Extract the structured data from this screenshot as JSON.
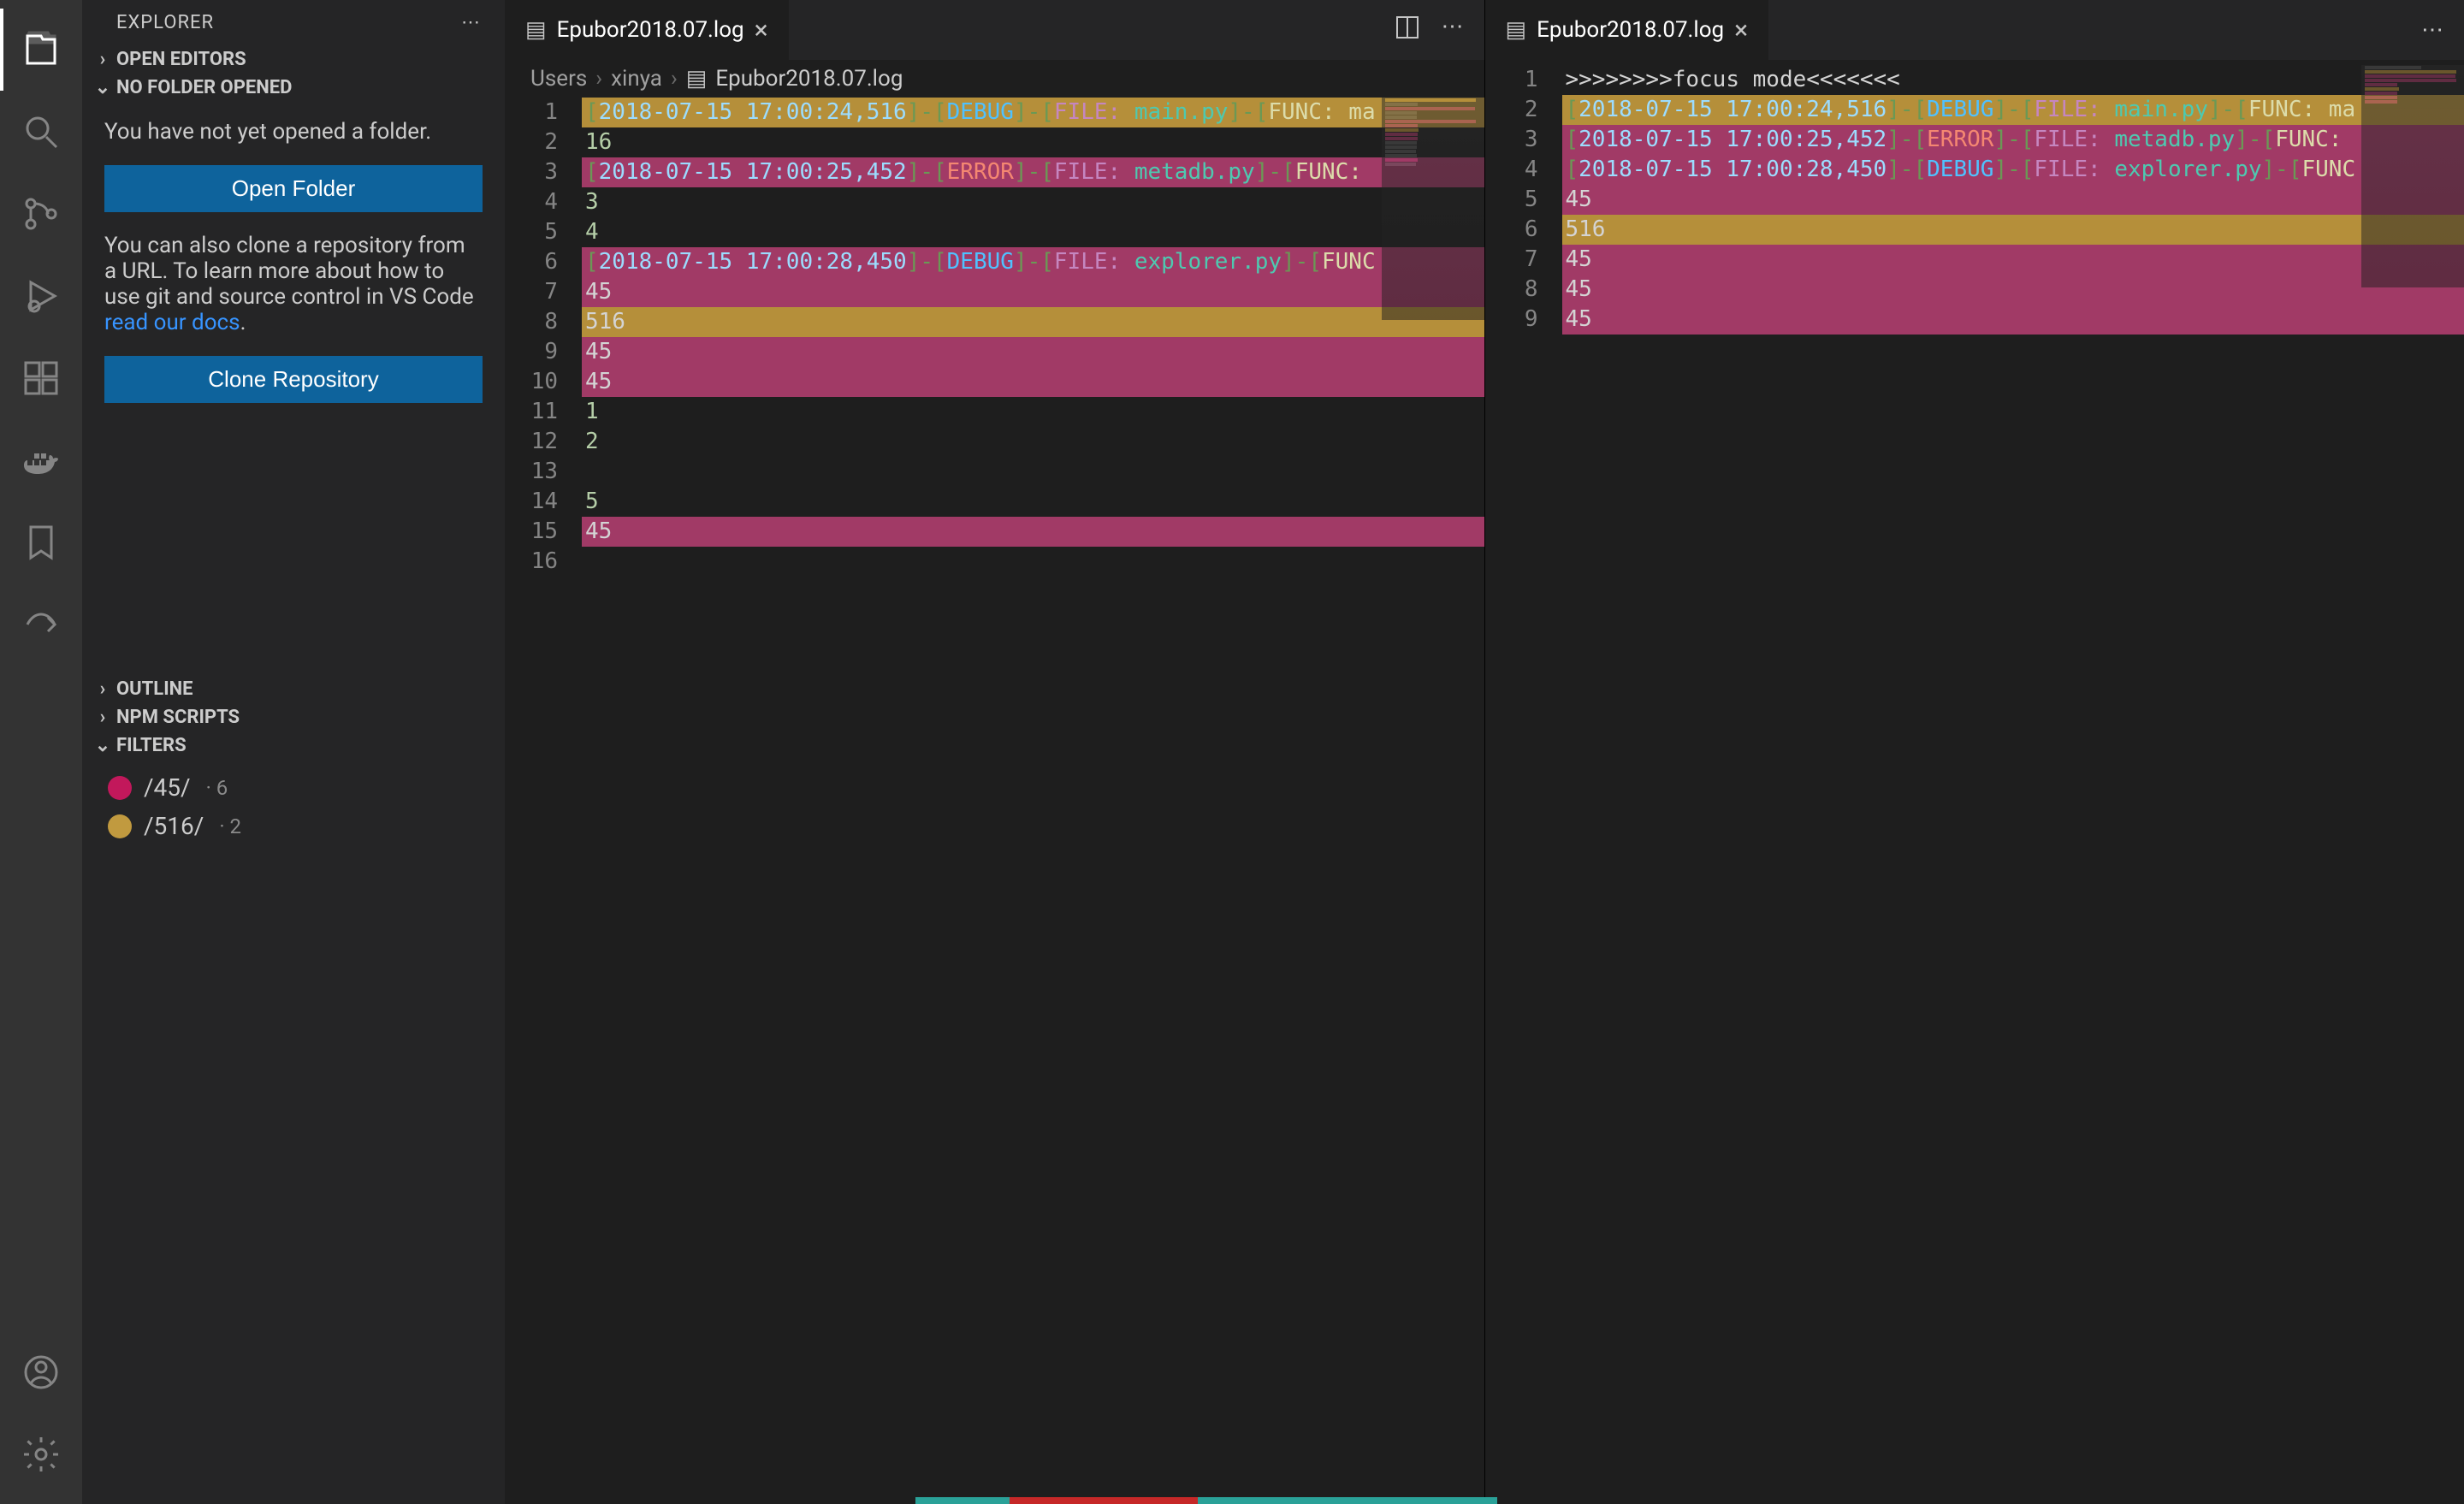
{
  "sidebar": {
    "title": "EXPLORER",
    "sections": {
      "openEditors": "OPEN EDITORS",
      "noFolder": "NO FOLDER OPENED",
      "outline": "OUTLINE",
      "npmScripts": "NPM SCRIPTS",
      "filters": "FILTERS"
    },
    "noFolderMsg": "You have not yet opened a folder.",
    "openFolderBtn": "Open Folder",
    "cloneMsg1": "You can also clone a repository from a URL. To learn more about how to use git and source control in VS Code ",
    "cloneLink": "read our docs",
    "cloneMsg2": ".",
    "cloneBtn": "Clone Repository",
    "filters": [
      {
        "pattern": "/45/",
        "count": "· 6",
        "color": "pink"
      },
      {
        "pattern": "/516/",
        "count": "· 2",
        "color": "gold"
      }
    ]
  },
  "editorLeft": {
    "tabName": "Epubor2018.07.log",
    "breadcrumb": [
      "Users",
      "xinya",
      "Epubor2018.07.log"
    ],
    "lines": [
      {
        "n": 1,
        "hl": "gold",
        "tokens": [
          [
            "[",
            "bracket"
          ],
          [
            "2018-07-15 17:00:24,516",
            "date"
          ],
          [
            "]-[",
            "bracket"
          ],
          [
            "DEBUG",
            "debug"
          ],
          [
            "]-[",
            "bracket"
          ],
          [
            "FILE: ",
            "label"
          ],
          [
            "main.py",
            "file"
          ],
          [
            "]-[",
            "bracket"
          ],
          [
            "FUNC: ma",
            "func"
          ]
        ]
      },
      {
        "n": 2,
        "hl": "",
        "tokens": [
          [
            "16",
            "num"
          ]
        ]
      },
      {
        "n": 3,
        "hl": "pink",
        "tokens": [
          [
            "[",
            "bracket"
          ],
          [
            "2018-07-15 17:00:25,452",
            "date"
          ],
          [
            "]-[",
            "bracket"
          ],
          [
            "ERROR",
            "error"
          ],
          [
            "]-[",
            "bracket"
          ],
          [
            "FILE: ",
            "label"
          ],
          [
            "metadb.py",
            "file"
          ],
          [
            "]-[",
            "bracket"
          ],
          [
            "FUNC:",
            "func"
          ]
        ]
      },
      {
        "n": 4,
        "hl": "",
        "tokens": [
          [
            "3",
            "num"
          ]
        ]
      },
      {
        "n": 5,
        "hl": "",
        "tokens": [
          [
            "4",
            "num"
          ]
        ]
      },
      {
        "n": 6,
        "hl": "pink",
        "tokens": [
          [
            "[",
            "bracket"
          ],
          [
            "2018-07-15 17:00:28,450",
            "date"
          ],
          [
            "]-[",
            "bracket"
          ],
          [
            "DEBUG",
            "debug"
          ],
          [
            "]-[",
            "bracket"
          ],
          [
            "FILE: ",
            "label"
          ],
          [
            "explorer.py",
            "file"
          ],
          [
            "]-[",
            "bracket"
          ],
          [
            "FUNC",
            "func"
          ]
        ]
      },
      {
        "n": 7,
        "hl": "pink",
        "tokens": [
          [
            "45",
            "plain"
          ]
        ]
      },
      {
        "n": 8,
        "hl": "gold",
        "tokens": [
          [
            "516",
            "plain"
          ]
        ]
      },
      {
        "n": 9,
        "hl": "pink",
        "tokens": [
          [
            "45",
            "plain"
          ]
        ]
      },
      {
        "n": 10,
        "hl": "pink",
        "tokens": [
          [
            "45",
            "plain"
          ]
        ]
      },
      {
        "n": 11,
        "hl": "",
        "tokens": [
          [
            "1",
            "num"
          ]
        ]
      },
      {
        "n": 12,
        "hl": "",
        "tokens": [
          [
            "2",
            "num"
          ]
        ]
      },
      {
        "n": 13,
        "hl": "",
        "tokens": []
      },
      {
        "n": 14,
        "hl": "",
        "tokens": [
          [
            "5",
            "num"
          ]
        ]
      },
      {
        "n": 15,
        "hl": "pink",
        "tokens": [
          [
            "45",
            "plain"
          ]
        ]
      },
      {
        "n": 16,
        "hl": "",
        "tokens": []
      }
    ]
  },
  "editorRight": {
    "tabName": "Epubor2018.07.log",
    "lines": [
      {
        "n": 1,
        "hl": "",
        "tokens": [
          [
            ">>>>>>>>focus mode<<<<<<<",
            "plain"
          ]
        ]
      },
      {
        "n": 2,
        "hl": "gold",
        "tokens": [
          [
            "[",
            "bracket"
          ],
          [
            "2018-07-15 17:00:24,516",
            "date"
          ],
          [
            "]-[",
            "bracket"
          ],
          [
            "DEBUG",
            "debug"
          ],
          [
            "]-[",
            "bracket"
          ],
          [
            "FILE: ",
            "label"
          ],
          [
            "main.py",
            "file"
          ],
          [
            "]-[",
            "bracket"
          ],
          [
            "FUNC: ma",
            "func"
          ]
        ]
      },
      {
        "n": 3,
        "hl": "pink",
        "tokens": [
          [
            "[",
            "bracket"
          ],
          [
            "2018-07-15 17:00:25,452",
            "date"
          ],
          [
            "]-[",
            "bracket"
          ],
          [
            "ERROR",
            "error"
          ],
          [
            "]-[",
            "bracket"
          ],
          [
            "FILE: ",
            "label"
          ],
          [
            "metadb.py",
            "file"
          ],
          [
            "]-[",
            "bracket"
          ],
          [
            "FUNC:",
            "func"
          ]
        ]
      },
      {
        "n": 4,
        "hl": "pink",
        "tokens": [
          [
            "[",
            "bracket"
          ],
          [
            "2018-07-15 17:00:28,450",
            "date"
          ],
          [
            "]-[",
            "bracket"
          ],
          [
            "DEBUG",
            "debug"
          ],
          [
            "]-[",
            "bracket"
          ],
          [
            "FILE: ",
            "label"
          ],
          [
            "explorer.py",
            "file"
          ],
          [
            "]-[",
            "bracket"
          ],
          [
            "FUNC",
            "func"
          ]
        ]
      },
      {
        "n": 5,
        "hl": "pink",
        "tokens": [
          [
            "45",
            "plain"
          ]
        ]
      },
      {
        "n": 6,
        "hl": "gold",
        "tokens": [
          [
            "516",
            "plain"
          ]
        ]
      },
      {
        "n": 7,
        "hl": "pink",
        "tokens": [
          [
            "45",
            "plain"
          ]
        ]
      },
      {
        "n": 8,
        "hl": "pink",
        "tokens": [
          [
            "45",
            "plain"
          ]
        ]
      },
      {
        "n": 9,
        "hl": "pink",
        "tokens": [
          [
            "45",
            "plain"
          ]
        ]
      }
    ]
  }
}
